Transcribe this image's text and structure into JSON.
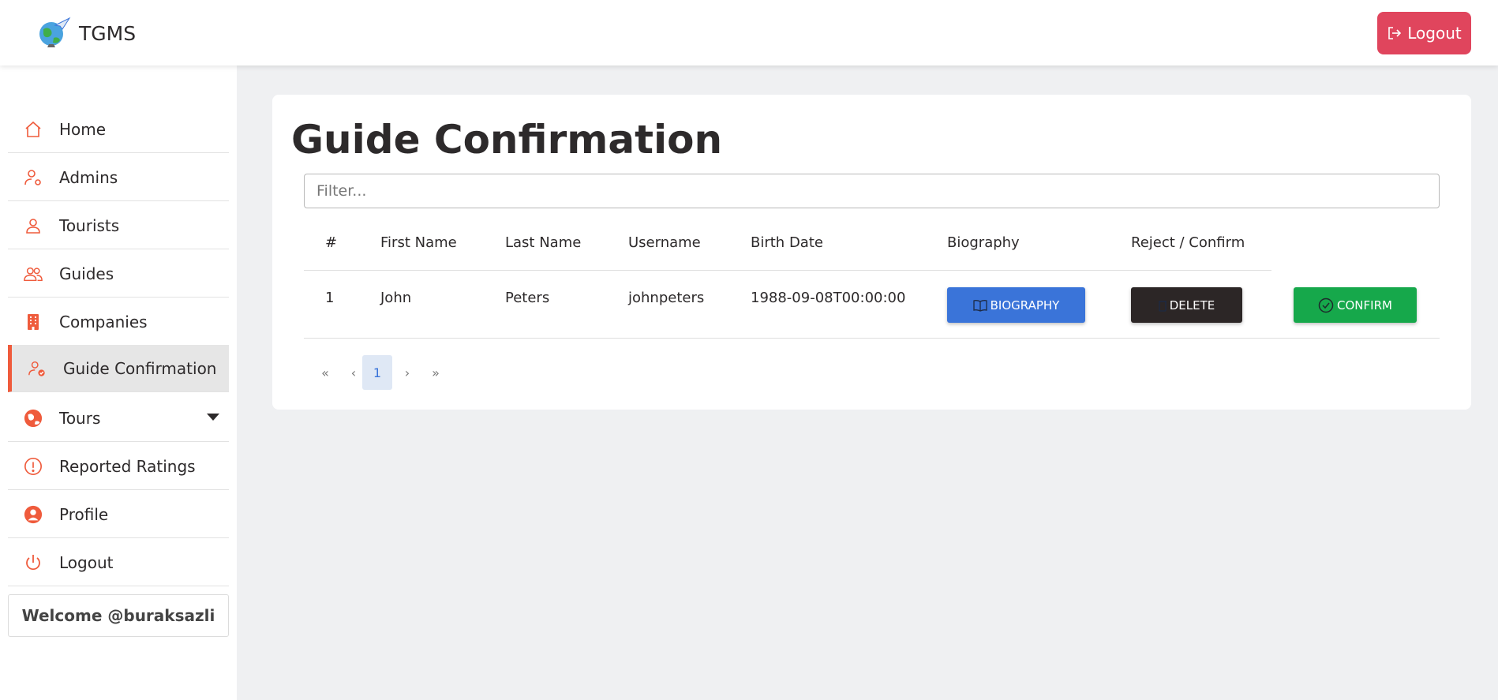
{
  "app": {
    "name": "TGMS",
    "logout_label": "Logout"
  },
  "sidebar": {
    "items": [
      {
        "label": "Home",
        "icon": "home-icon"
      },
      {
        "label": "Admins",
        "icon": "user-gear-icon"
      },
      {
        "label": "Tourists",
        "icon": "user-icon"
      },
      {
        "label": "Guides",
        "icon": "users-icon"
      },
      {
        "label": "Companies",
        "icon": "building-icon"
      },
      {
        "label": "Guide Confirmation",
        "icon": "user-check-icon",
        "active": true
      },
      {
        "label": "Tours",
        "icon": "globe-icon",
        "has_dropdown": true
      },
      {
        "label": "Reported Ratings",
        "icon": "exclamation-icon"
      },
      {
        "label": "Profile",
        "icon": "user-circle-icon"
      },
      {
        "label": "Logout",
        "icon": "power-icon"
      }
    ],
    "welcome": "Welcome @buraksazli"
  },
  "main": {
    "title": "Guide Confirmation",
    "filter_placeholder": "Filter...",
    "columns": [
      "#",
      "First Name",
      "Last Name",
      "Username",
      "Birth Date",
      "Biography",
      "Reject / Confirm"
    ],
    "rows": [
      {
        "num": "1",
        "first_name": "John",
        "last_name": "Peters",
        "username": "johnpeters",
        "birth_date": "1988-09-08T00:00:00"
      }
    ],
    "buttons": {
      "biography": "BIOGRAPHY",
      "delete": "DELETE",
      "confirm": "CONFIRM"
    },
    "pagination": {
      "first": "«",
      "prev": "‹",
      "current": "1",
      "next": "›",
      "last": "»"
    }
  },
  "colors": {
    "accent": "#ef5b3c",
    "logout": "#e0455d",
    "primary": "#3a74d9",
    "dark": "#2c2626",
    "success": "#16a84b"
  }
}
